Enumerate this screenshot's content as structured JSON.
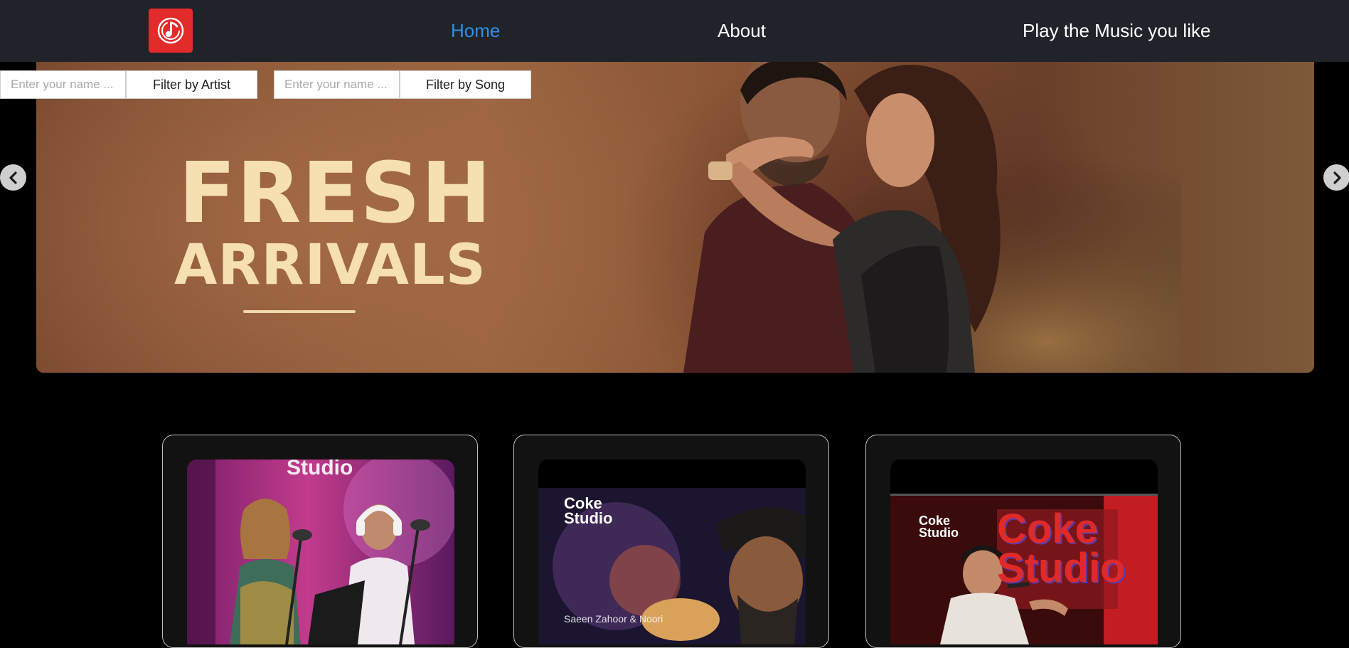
{
  "nav": {
    "logo_icon": "music-note-icon",
    "home_label": "Home",
    "about_label": "About",
    "play_label": "Play the Music you like",
    "active_color": "#2f8fe6",
    "background": "#20232a"
  },
  "filters": {
    "artist": {
      "placeholder": "Enter your name ...",
      "value": "",
      "button_label": "Filter by Artist"
    },
    "song": {
      "placeholder": "Enter your name ...",
      "value": "",
      "button_label": "Filter by Song"
    }
  },
  "banner": {
    "line1": "FRESH",
    "line2": "ARRIVALS",
    "prev_icon": "chevron-left-icon",
    "next_icon": "chevron-right-icon"
  },
  "cards": [
    {
      "thumb_text": "Studio"
    },
    {
      "thumb_text": "Coke Studio",
      "caption": "Saeen Zahoor & Noori"
    },
    {
      "thumb_text": "Coke Studio",
      "overlay": "Coke Studio"
    }
  ],
  "brand_color": "#e32b2b"
}
